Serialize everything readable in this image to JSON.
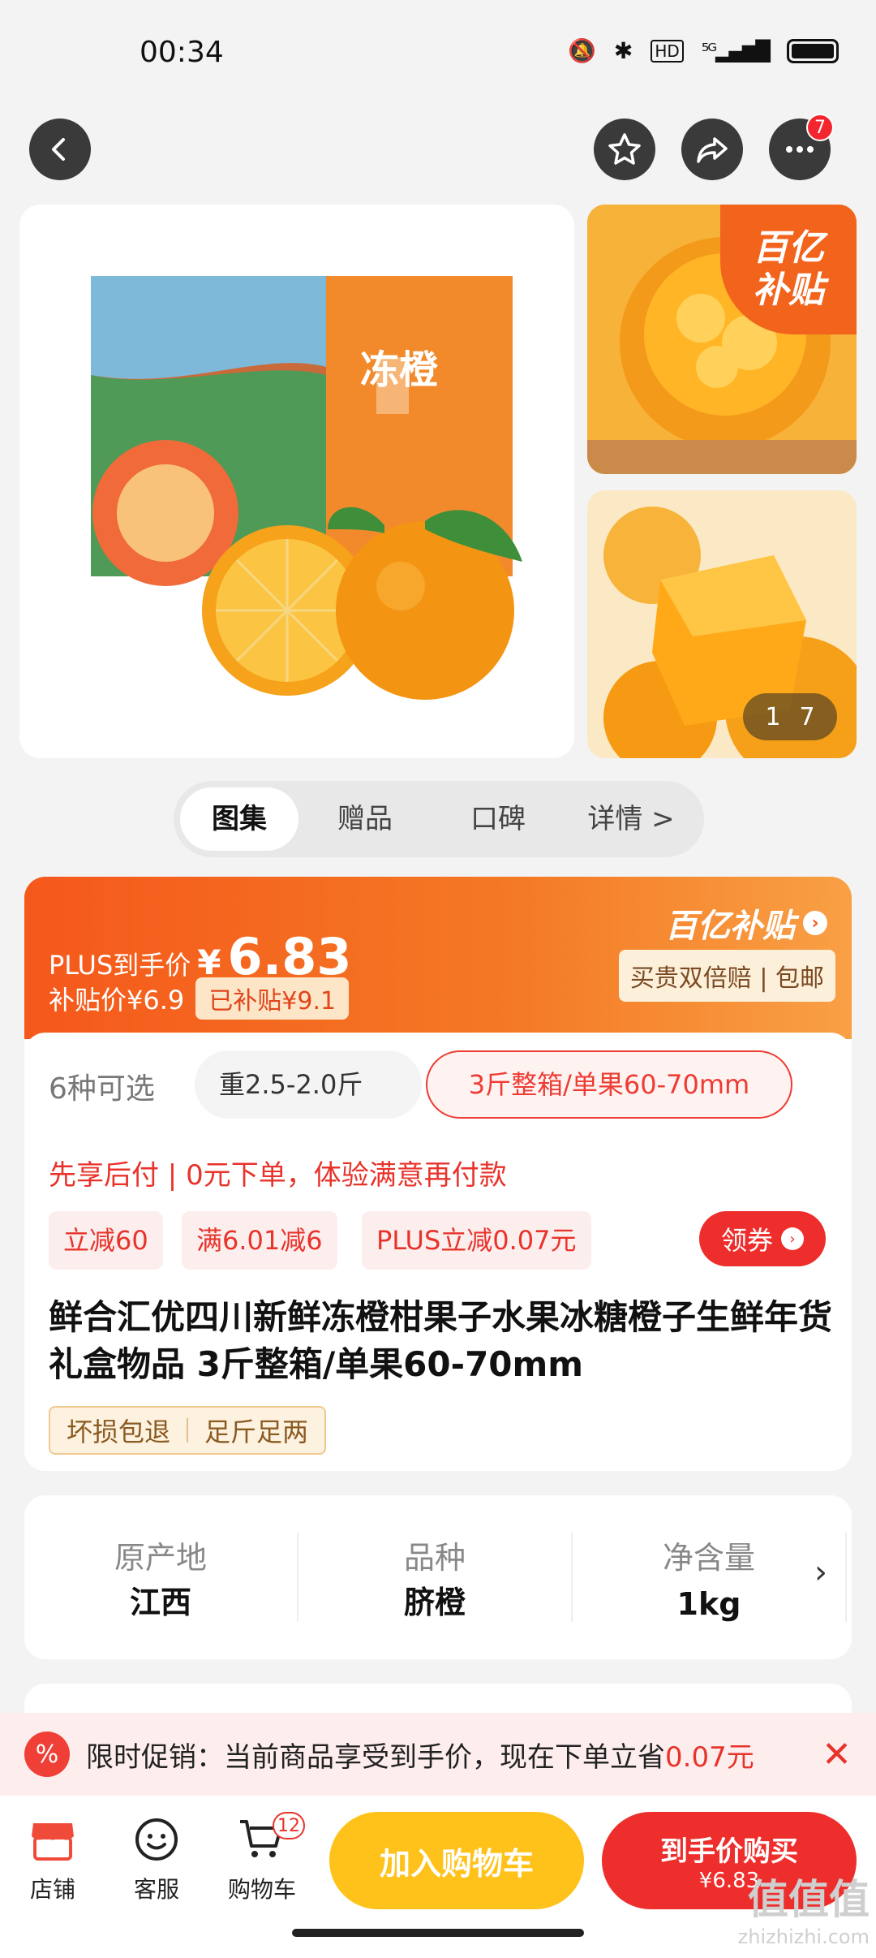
{
  "status": {
    "time": "00:34"
  },
  "header": {
    "more_badge": "7"
  },
  "gallery": {
    "subsidy_corner_lines": [
      "百亿",
      "补贴"
    ],
    "counter_current": "1",
    "counter_total": "7",
    "box_label": "冻橙"
  },
  "tabs": [
    "图集",
    "赠品",
    "口碑",
    "详情 >"
  ],
  "price": {
    "plus_label": "PLUS到手价",
    "currency": "¥",
    "amount": "6.83",
    "subsidy_price_label": "补贴价¥6.9",
    "subsidized": "已补贴¥9.1",
    "brand": "百亿补贴",
    "brand_note": "买贵双倍赔 | 包邮"
  },
  "options": {
    "count": "6种可选",
    "option_a": "重2.5-2.0斤",
    "option_b": "3斤整箱/单果60-70mm"
  },
  "paylater": "先享后付 | 0元下单，体验满意再付款",
  "coupons": [
    "立减60",
    "满6.01减6",
    "PLUS立减0.07元"
  ],
  "get_coupon": "领券",
  "product_title": "鲜合汇优四川新鲜冻橙柑果子水果冰糖橙子生鲜年货礼盒物品 3斤整箱/单果60-70mm",
  "service_tags": [
    "坏损包退",
    "足斤足两"
  ],
  "attributes": [
    {
      "key": "原产地",
      "value": "江西"
    },
    {
      "key": "品种",
      "value": "脐橙"
    },
    {
      "key": "净含量",
      "value": "1kg"
    }
  ],
  "promo": {
    "text": "限时促销：当前商品享受到手价，现在下单立省",
    "saving": "0.07元"
  },
  "bottom_nav": [
    {
      "label": "店铺",
      "icon": "store-icon"
    },
    {
      "label": "客服",
      "icon": "service-icon"
    },
    {
      "label": "购物车",
      "icon": "cart-icon",
      "badge": "12"
    }
  ],
  "add_to_cart": "加入购物车",
  "buy_now": {
    "line1": "到手价购买",
    "line2": "¥6.83"
  },
  "watermark": {
    "line1": "值值值",
    "line2": "zhizhizhi.com"
  }
}
